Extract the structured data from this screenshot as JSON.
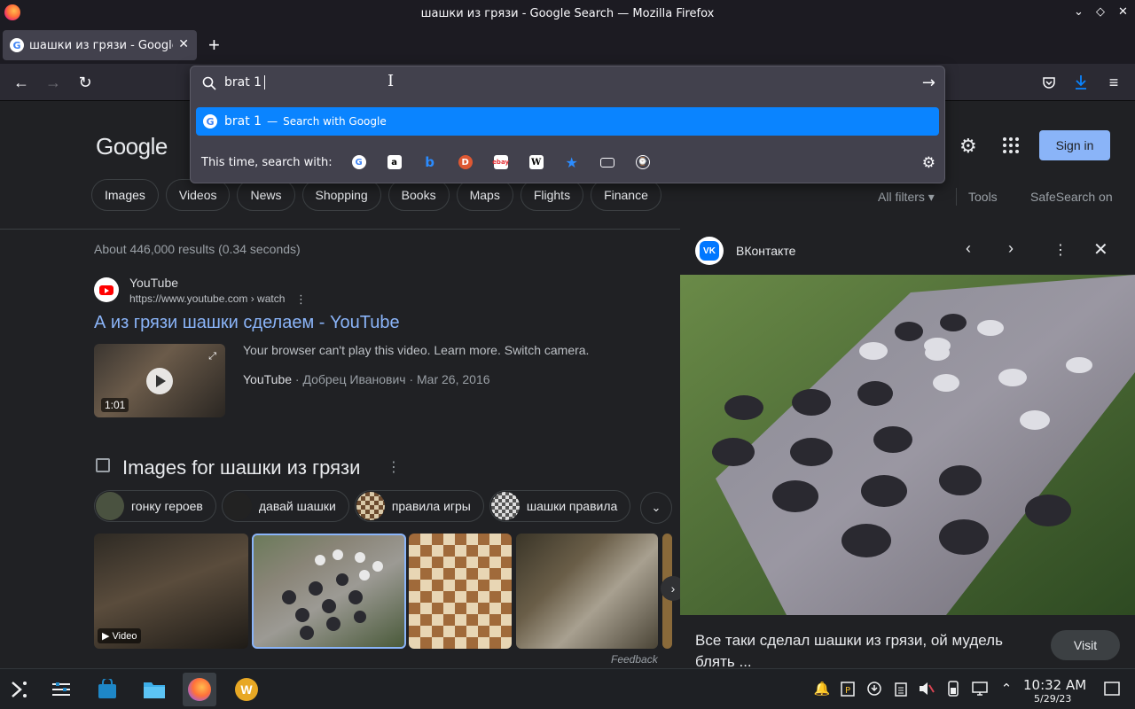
{
  "window": {
    "title": "шашки из грязи - Google Search — Mozilla Firefox"
  },
  "tab": {
    "title": "шашки из грязи - Google",
    "close": "✕",
    "new_tab": "+"
  },
  "urlbar": {
    "typed": "brat 1",
    "suggestion_text": "brat 1",
    "suggestion_sep": "—",
    "suggestion_action": "Search with Google",
    "engines_label": "This time, search with:",
    "engines": [
      "google-icon",
      "amazon-icon",
      "bing-icon",
      "duckduckgo-icon",
      "ebay-icon",
      "wikipedia-icon",
      "bookmarks-icon",
      "tabs-icon",
      "history-icon"
    ]
  },
  "google": {
    "logo": "Google",
    "sign_in": "Sign in",
    "chips": [
      "Images",
      "Videos",
      "News",
      "Shopping",
      "Books",
      "Maps",
      "Flights",
      "Finance"
    ],
    "all_filters": "All filters",
    "tools": "Tools",
    "safesearch": "SafeSearch on",
    "stats": "About 446,000 results (0.34 seconds)"
  },
  "result": {
    "site_name": "YouTube",
    "site_url": "https://www.youtube.com › watch",
    "title": "А из грязи шашки сделаем - YouTube",
    "duration": "1:01",
    "snippet": "Your browser can't play this video. Learn more. Switch camera.",
    "source": "YouTube",
    "meta_rest": " · Добрец Иванович · Mar 26, 2016"
  },
  "images": {
    "heading": "Images for шашки из грязи",
    "chips": [
      "гонку героев",
      "давай шашки",
      "правила игры",
      "шашки правила"
    ],
    "video_badge": "▶ Video",
    "feedback": "Feedback"
  },
  "preview": {
    "source": "ВКонтакте",
    "vk_logo": "VK",
    "caption": "Все таки сделал шашки из грязи, ой мудель блять ...",
    "visit": "Visit"
  },
  "clock": {
    "time": "10:32 AM",
    "date": "5/29/23"
  },
  "colors": {
    "accent": "#0a84ff",
    "link": "#8ab4f8",
    "page_bg": "#202124"
  }
}
